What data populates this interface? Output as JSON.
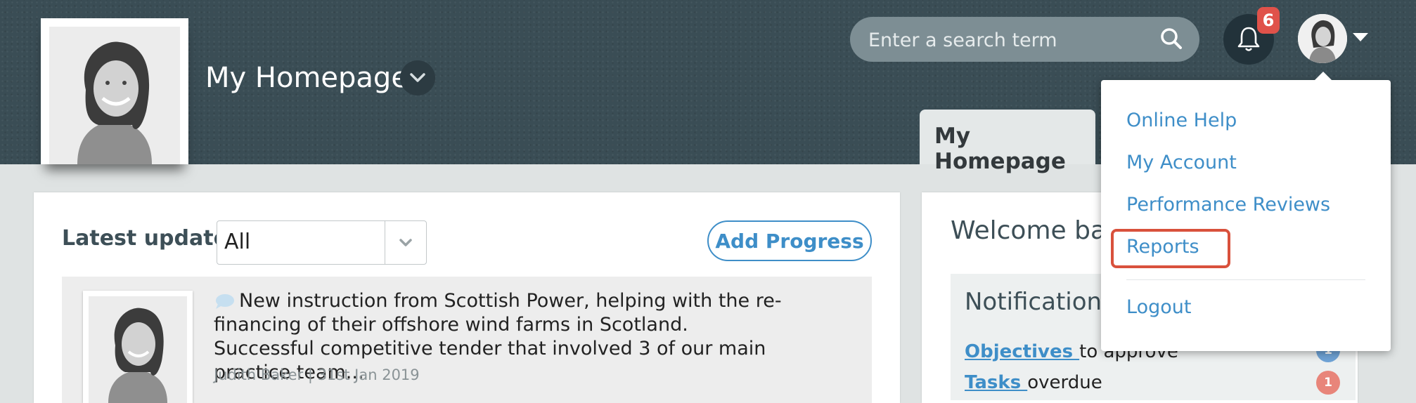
{
  "header": {
    "page_title": "My Homepage",
    "search": {
      "placeholder": "Enter a search term"
    },
    "notifications_count": "6"
  },
  "tabs": [
    {
      "label": "My Homepage",
      "active": true
    }
  ],
  "user_menu": {
    "items": [
      {
        "label": "Online Help"
      },
      {
        "label": "My Account"
      },
      {
        "label": "Performance Reviews"
      },
      {
        "label": "Reports",
        "highlighted": true
      },
      {
        "label": "Logout"
      }
    ]
  },
  "updates": {
    "label": "Latest updates",
    "filter_value": "All",
    "add_progress_label": "Add Progress",
    "items": [
      {
        "text": "New instruction from Scottish Power, helping with the re-financing of their offshore wind farms in Scotland. Successful competitive tender that involved 3 of our main practice team...",
        "author": "Judith Baker",
        "separator": "|",
        "date": "31st Jan 2019"
      }
    ]
  },
  "welcome": {
    "text": "Welcome bac"
  },
  "notifications": {
    "title": "Notifications",
    "rows": [
      {
        "link": "Objectives ",
        "text": "to approve",
        "count": "1",
        "badge_color": "#6fa3d6"
      },
      {
        "link": "Tasks ",
        "text": "overdue",
        "count": "1",
        "badge_color": "#e8857a"
      }
    ]
  },
  "colors": {
    "header_bg": "#3a4d55",
    "accent": "#3e8ec8",
    "highlight_border": "#d9513c",
    "badge_red": "#e0524a"
  }
}
